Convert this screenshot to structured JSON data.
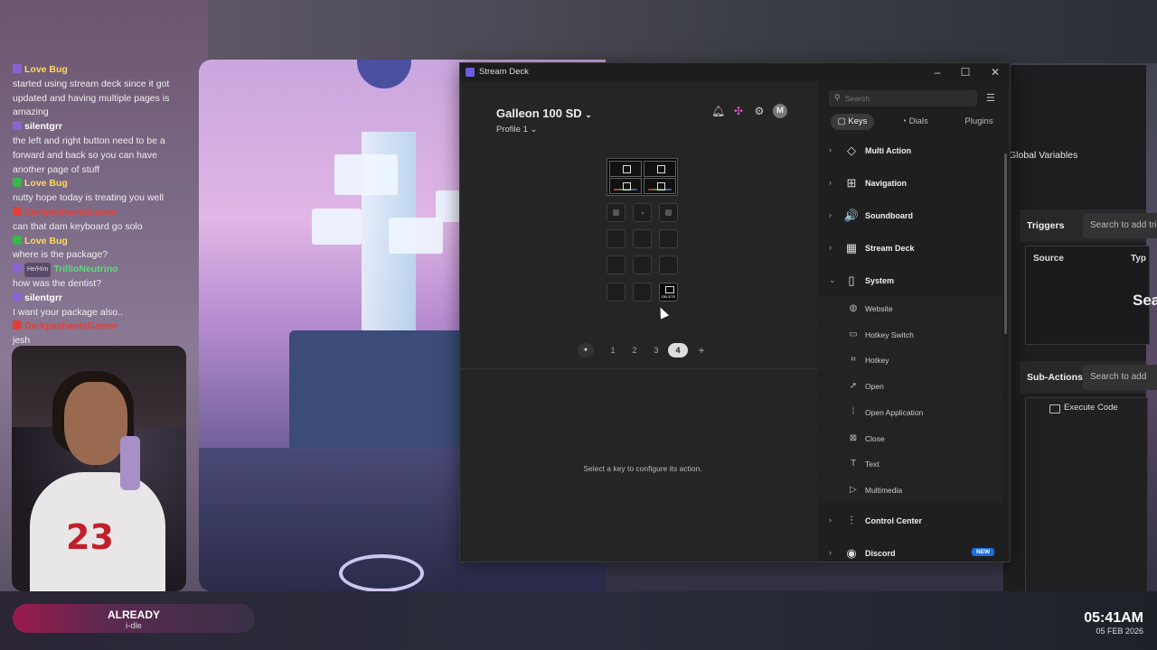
{
  "chat": [
    {
      "user": "Love Bug",
      "color": "#ffd75a",
      "badge": "#8a63d2",
      "message": "started using stream deck since it got updated and having multiple pages is amazing"
    },
    {
      "user": "silentgrr",
      "color": "#ffffff",
      "badge": "#8a63d2",
      "message": "the left and right button need to be a forward and back so you can have another page of stuff"
    },
    {
      "user": "Love Bug",
      "color": "#ffd75a",
      "badge": "#39b54a",
      "message": "nutty hope today is treating you well"
    },
    {
      "user": "DarkpashantsGamer",
      "color": "#e0403a",
      "badge": "#e0403a",
      "message": "can that dam keyboard go solo"
    },
    {
      "user": "Love Bug",
      "color": "#ffd75a",
      "badge": "#39b54a",
      "message": "where is the package?"
    },
    {
      "user": "TrillioNeutrino",
      "color": "#5ddc7a",
      "badge": "#8a63d2",
      "pronoun": "He/Him",
      "message": "how was the dentist?"
    },
    {
      "user": "silentgrr",
      "color": "#ffffff",
      "badge": "#8a63d2",
      "message": "I want your package also.."
    },
    {
      "user": "DarkpashantsGamer",
      "color": "#e0403a",
      "badge": "#e0403a",
      "message": "jesh"
    }
  ],
  "streamdeck": {
    "window_title": "Stream Deck",
    "device": "Galleon 100 SD",
    "profile": "Profile 1",
    "hint": "Select a key to configure its action.",
    "pages": [
      "1",
      "2",
      "3",
      "4"
    ],
    "active_page": "4",
    "delete_key_label": "DELETE",
    "search_placeholder": "Search",
    "tabs": [
      "Keys",
      "Dials",
      "Plugins"
    ],
    "categories": [
      {
        "label": "Multi Action",
        "icon": "◇"
      },
      {
        "label": "Navigation",
        "icon": "⊞"
      },
      {
        "label": "Soundboard",
        "icon": "🔊"
      },
      {
        "label": "Stream Deck",
        "icon": "▦"
      },
      {
        "label": "System",
        "icon": "▯"
      }
    ],
    "system_items": [
      {
        "label": "Website",
        "icon": "◍"
      },
      {
        "label": "Hotkey Switch",
        "icon": "▭"
      },
      {
        "label": "Hotkey",
        "icon": "⌗"
      },
      {
        "label": "Open",
        "icon": "➚"
      },
      {
        "label": "Open Application",
        "icon": "⁞"
      },
      {
        "label": "Close",
        "icon": "⊠"
      },
      {
        "label": "Text",
        "icon": "T"
      },
      {
        "label": "Multimedia",
        "icon": "▷"
      }
    ],
    "more_categories": [
      {
        "label": "Control Center",
        "icon": "⫶"
      },
      {
        "label": "Discord",
        "icon": "◉",
        "badge": "NEW"
      }
    ]
  },
  "app_behind": {
    "title": "Global Variables",
    "triggers_label": "Triggers",
    "triggers_search": "Search to add trig",
    "col_source": "Source",
    "col_type": "Typ",
    "search_big": "Sea",
    "subactions_label": "Sub-Actions",
    "subactions_search": "Search to add",
    "execute_code": "Execute Code"
  },
  "now_playing": {
    "title": "ALREADY",
    "artist": "i-dle"
  },
  "clock": {
    "time": "05:41AM",
    "date": "05 FEB 2026"
  }
}
